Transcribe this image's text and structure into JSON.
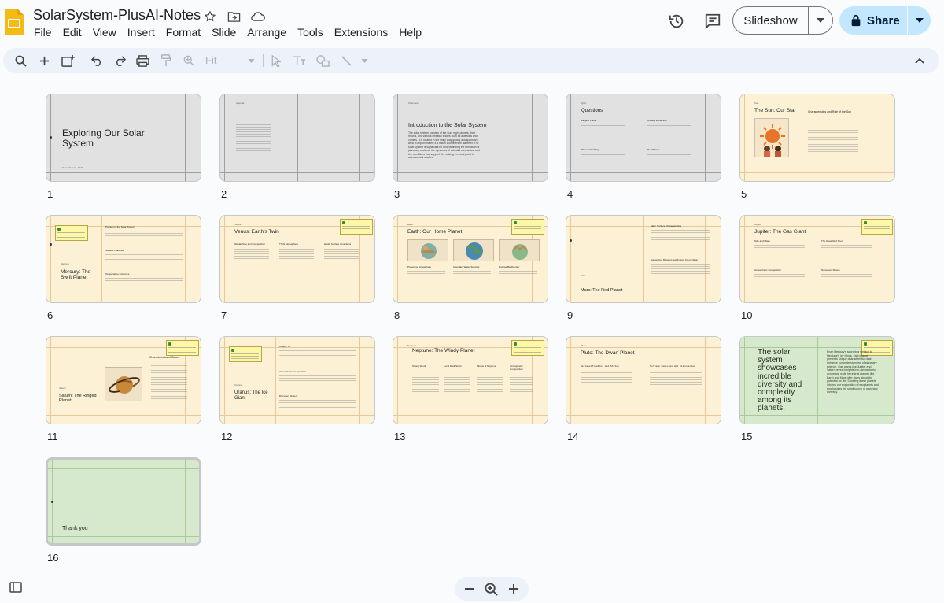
{
  "app": {
    "title": "SolarSystem-PlusAI-Notes",
    "menu": [
      "File",
      "Edit",
      "View",
      "Insert",
      "Format",
      "Slide",
      "Arrange",
      "Tools",
      "Extensions",
      "Help"
    ],
    "slideshow_label": "Slideshow",
    "share_label": "Share",
    "zoom_fit_label": "Fit"
  },
  "slides": [
    {
      "num": "1",
      "title": "Exploring Our Solar System",
      "footer": "November 22, 2024"
    },
    {
      "num": "2",
      "title": "Agenda"
    },
    {
      "num": "3",
      "title": "Introduction to the Solar System",
      "header": "Overview",
      "body": "The solar system consists of the Sun, eight planets, their moons, and various celestial bodies such as asteroids and comets. It is located in the Milky Way galaxy and spans an area of approximately 4.5 billion kilometers in diameter. The solar system is significant for understanding the formation of planetary systems, the dynamics of celestial mechanics, and the conditions that support life, making it a focal point for astronomical studies."
    },
    {
      "num": "4",
      "title": "Questions",
      "header": "Quiz",
      "sub": [
        "Largest Planet",
        "Closest to the Sun",
        "Planet with Rings",
        "Red Planet"
      ]
    },
    {
      "num": "5",
      "title": "The Sun: Our Star",
      "header": "Sun",
      "sub": [
        "Characteristics and Role of the Sun"
      ]
    },
    {
      "num": "6",
      "title": "Mercury: The Swift Planet",
      "header": "Mercury",
      "sub": [
        "Position in the Solar System",
        "Surface Features",
        "Temperature Extremes"
      ]
    },
    {
      "num": "7",
      "title": "Venus: Earth's Twin",
      "header": "Venus",
      "sub": [
        "Similar Size and Composition",
        "Thick Atmosphere",
        "Harsh Surface Conditions"
      ]
    },
    {
      "num": "8",
      "title": "Earth: Our Home Planet",
      "header": "Earth",
      "sub": [
        "Protective Atmosphere",
        "Abundant Water Sources",
        "Diverse Biodiversity"
      ]
    },
    {
      "num": "9",
      "title": "Mars: The Red Planet",
      "header": "Mars",
      "sub": [
        "Mars' Surface Characteristics",
        "Exploration Missions and Future Colonization"
      ]
    },
    {
      "num": "10",
      "title": "Jupiter: The Gas Giant",
      "header": "Jupiter",
      "sub": [
        "Size and Mass",
        "The Great Red Spot",
        "Atmospheric Composition",
        "Numerous Moons"
      ]
    },
    {
      "num": "11",
      "title": "Saturn: The Ringed Planet",
      "header": "Saturn",
      "sub": [
        "Characteristics of Saturn"
      ]
    },
    {
      "num": "12",
      "title": "Uranus: The Ice Giant",
      "header": "Uranus",
      "sub": [
        "Unique Tilt",
        "Atmospheric Composition",
        "Discovery History"
      ]
    },
    {
      "num": "13",
      "title": "Neptune: The Windy Planet",
      "header": "Neptune",
      "sub": [
        "Strong Winds",
        "Lucid Dark Storm",
        "Moons of Neptune",
        "Atmospheric Composition"
      ]
    },
    {
      "num": "14",
      "title": "Pluto: The Dwarf Planet",
      "header": "Pluto",
      "sub": [
        "Reclassification and Status",
        "Surface Features and Discoveries"
      ]
    },
    {
      "num": "15",
      "title": "The solar system showcases incredible diversity and complexity among its planets.",
      "body": "From Mercury's scorching surface to Neptune's icy winds, each planet presents unique characteristics that enhance our understanding of planetary science. Gas giants like Jupiter and Saturn reveal insights into atmospheric dynamics, while terrestrial planets like Earth and Mars offer clues about the potential for life. Studying these planets informs our exploration of exoplanets and emphasizes the significance of planetary diversity."
    },
    {
      "num": "16",
      "title": "Thank you"
    }
  ],
  "colors": {
    "cream": "#fdf1d5",
    "gray": "#e1e1e1",
    "green": "#d7e9cc",
    "accent": "#c2e7ff"
  }
}
